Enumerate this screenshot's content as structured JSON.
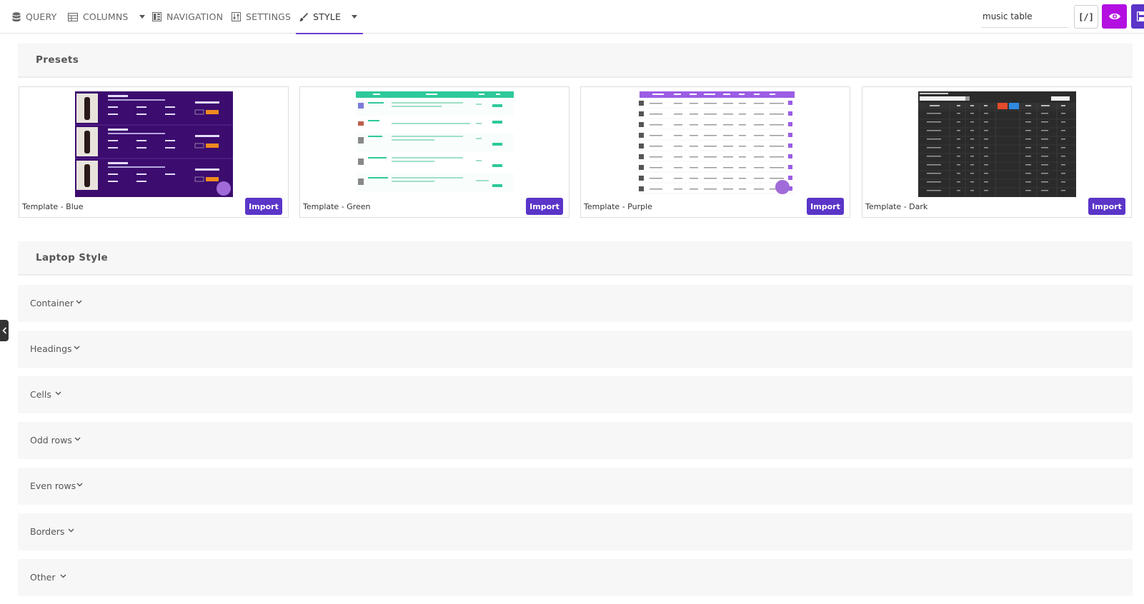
{
  "toolbar": {
    "tabs": [
      {
        "label": "QUERY",
        "icon": "database-icon"
      },
      {
        "label": "COLUMNS",
        "icon": "table-icon",
        "has_dropdown": true
      },
      {
        "label": "NAVIGATION",
        "icon": "navigation-icon"
      },
      {
        "label": "SETTINGS",
        "icon": "sliders-icon"
      },
      {
        "label": "STYLE",
        "icon": "paintbrush-icon",
        "has_dropdown": true,
        "active": true
      }
    ],
    "table_name": "music table",
    "shortcode_label": "[/]",
    "preview_icon": "eye-icon",
    "save_icon": "save-icon"
  },
  "presets": {
    "title": "Presets",
    "cards": [
      {
        "name": "Template - Blue",
        "button": "Import"
      },
      {
        "name": "Template - Green",
        "button": "Import"
      },
      {
        "name": "Template - Purple",
        "button": "Import"
      },
      {
        "name": "Template - Dark",
        "button": "Import"
      }
    ]
  },
  "laptop_style": {
    "title": "Laptop Style",
    "sections": [
      "Container",
      "Headings",
      "Cells",
      "Odd rows",
      "Even rows",
      "Borders",
      "Other"
    ]
  },
  "colors": {
    "accent": "#5a35c8",
    "preview_button": "#b30fe0",
    "blue_template_bg": "#3c0c6e",
    "green_template_header": "#2ec99b",
    "purple_template_header": "#9b5de5",
    "dark_template_bg": "#2b2b2b",
    "panel_bg": "#f7f7f7"
  }
}
